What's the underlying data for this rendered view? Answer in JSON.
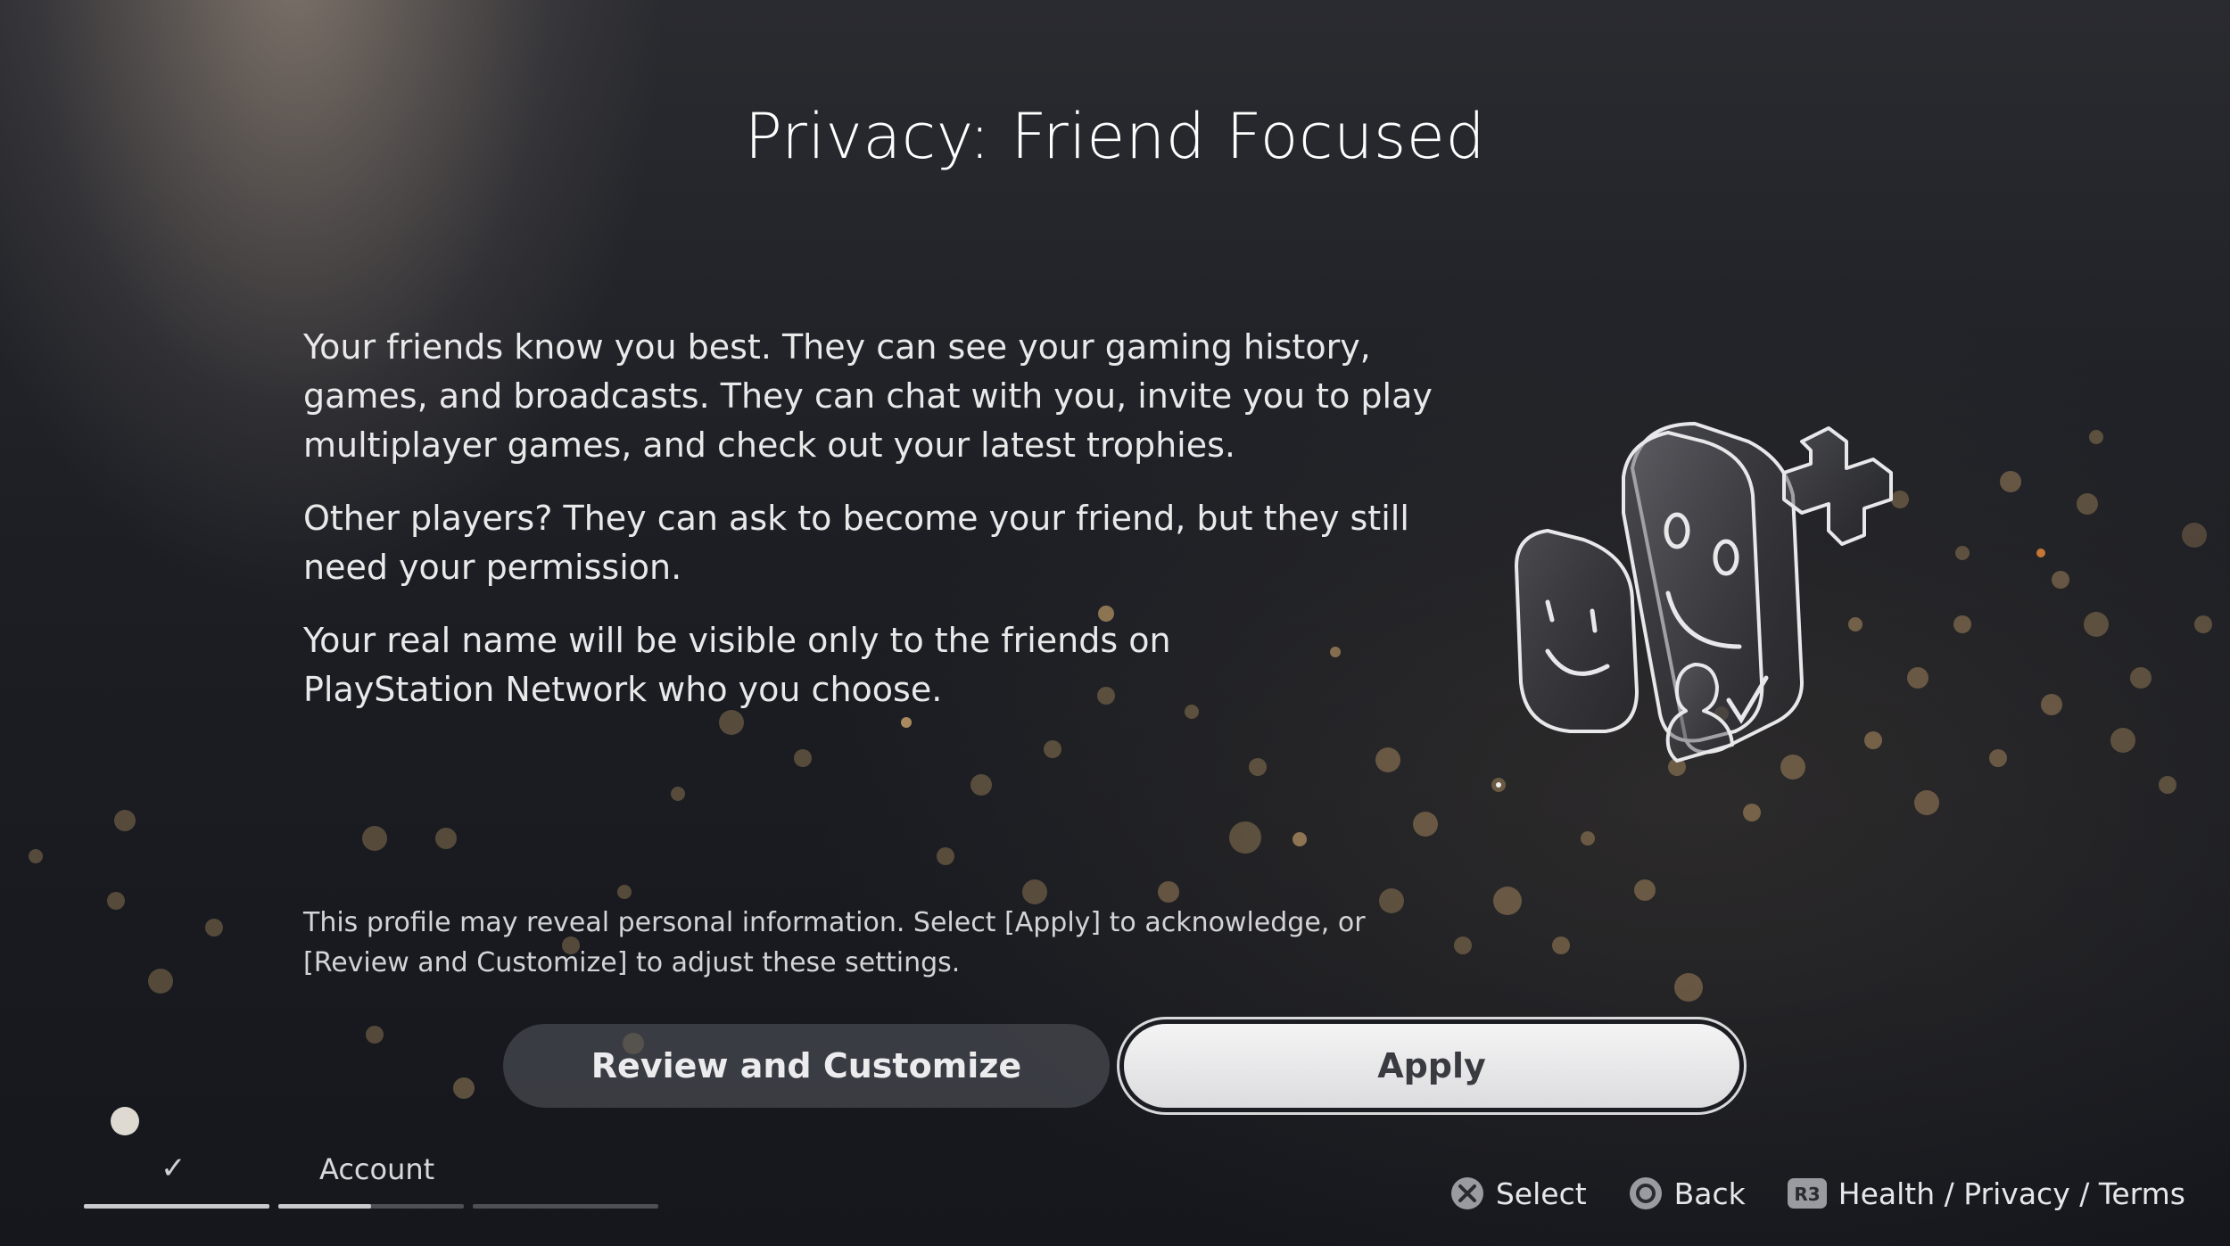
{
  "title": "Privacy: Friend Focused",
  "body": {
    "paragraph_1": "Your friends know you best. They can see your gaming history, games, and broadcasts. They can chat with you, invite you to play multiplayer games, and check out your latest trophies.",
    "paragraph_2": "Other players? They can ask to become your friend, but they still need your permission.",
    "paragraph_3": "Your real name will be visible only to the friends on PlayStation Network who you choose."
  },
  "notice": "This profile may reveal personal information. Select [Apply] to acknowledge, or [Review and Customize] to adjust these settings.",
  "buttons": {
    "review_label": "Review and Customize",
    "apply_label": "Apply"
  },
  "progress": {
    "current_step_label": "Account",
    "steps_total": 3,
    "completed_steps": 1,
    "current_step_fill": 0.5
  },
  "hints": {
    "select_label": "Select",
    "back_label": "Back",
    "r3_button": "R3",
    "terms_label": "Health / Privacy / Terms"
  },
  "illustration": {
    "icon": "friends-faces-icon"
  },
  "colors": {
    "apply_button": "#e8e8ea",
    "review_button": "#505258"
  }
}
